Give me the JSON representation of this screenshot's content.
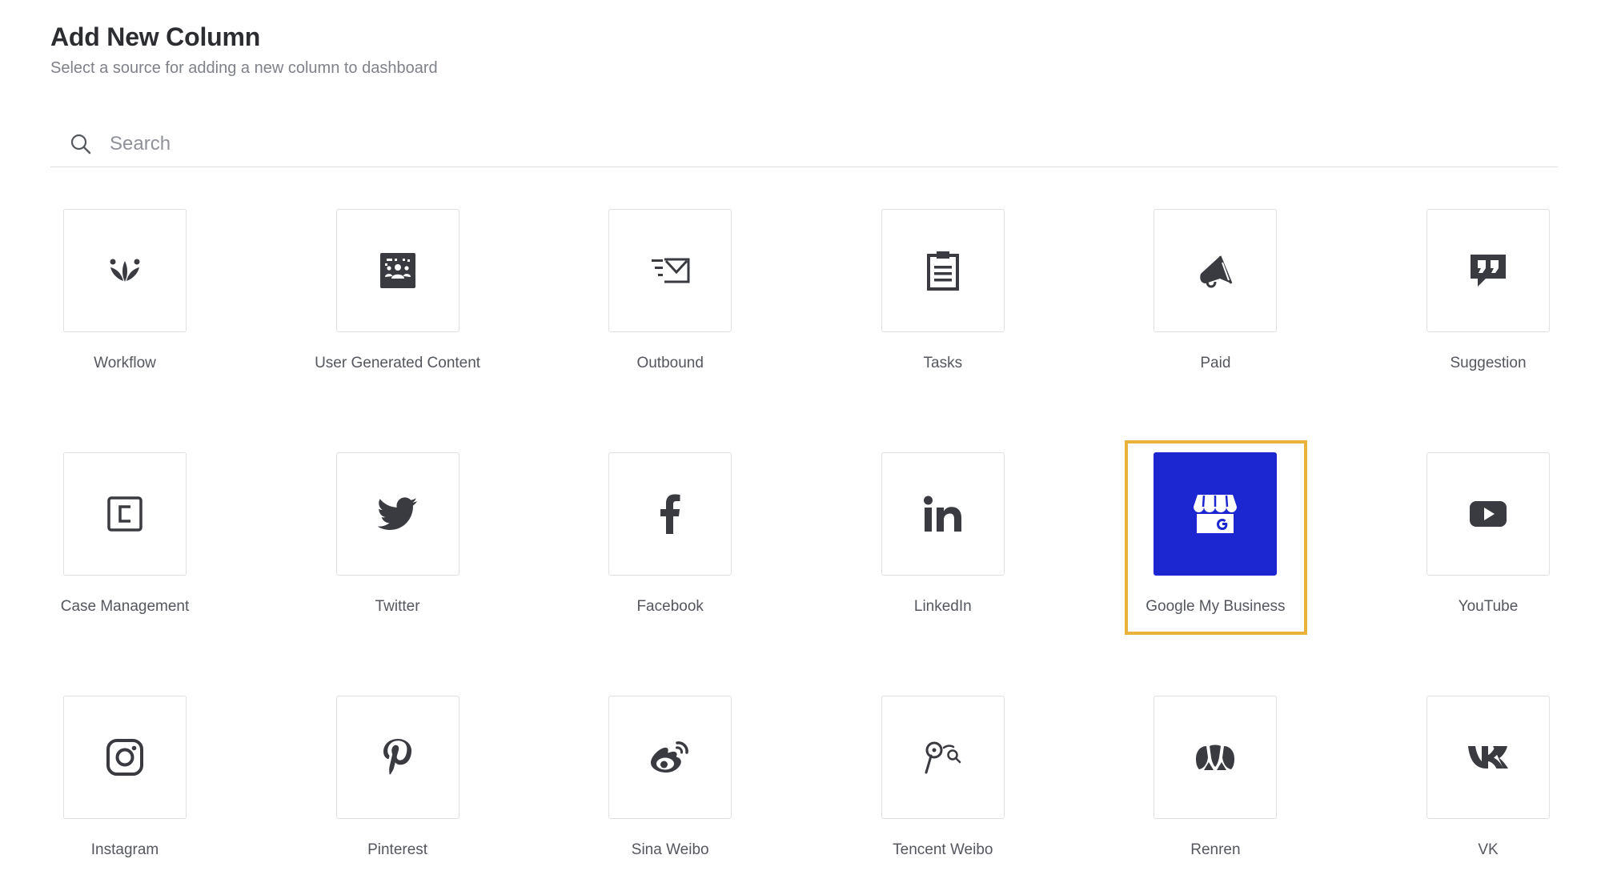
{
  "header": {
    "title": "Add New Column",
    "subtitle": "Select a source for adding a new column to dashboard"
  },
  "search": {
    "placeholder": "Search",
    "value": ""
  },
  "colors": {
    "selected_tile_bg": "#1c26d1",
    "selection_outline": "#e9b23d",
    "icon_dark": "#3a3b40"
  },
  "sources": [
    {
      "label": "Workflow",
      "icon": "workflow-icon"
    },
    {
      "label": "User Generated Content",
      "icon": "ugc-icon"
    },
    {
      "label": "Outbound",
      "icon": "outbound-icon"
    },
    {
      "label": "Tasks",
      "icon": "clipboard-icon"
    },
    {
      "label": "Paid",
      "icon": "megaphone-icon"
    },
    {
      "label": "Suggestion",
      "icon": "quote-bubble-icon"
    },
    {
      "label": "Case Management",
      "icon": "case-icon"
    },
    {
      "label": "Twitter",
      "icon": "twitter-icon"
    },
    {
      "label": "Facebook",
      "icon": "facebook-icon"
    },
    {
      "label": "LinkedIn",
      "icon": "linkedin-icon"
    },
    {
      "label": "Google My Business",
      "icon": "google-my-business-icon",
      "selected": true
    },
    {
      "label": "YouTube",
      "icon": "youtube-icon"
    },
    {
      "label": "Instagram",
      "icon": "instagram-icon"
    },
    {
      "label": "Pinterest",
      "icon": "pinterest-icon"
    },
    {
      "label": "Sina Weibo",
      "icon": "sina-weibo-icon"
    },
    {
      "label": "Tencent Weibo",
      "icon": "tencent-weibo-icon"
    },
    {
      "label": "Renren",
      "icon": "renren-icon"
    },
    {
      "label": "VK",
      "icon": "vk-icon"
    }
  ]
}
